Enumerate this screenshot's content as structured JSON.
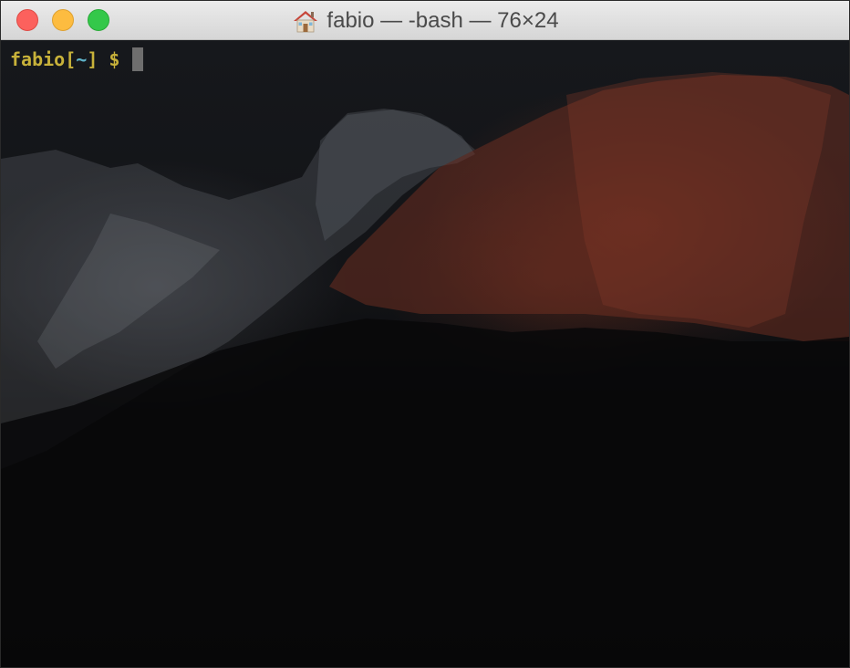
{
  "window": {
    "title": "fabio — -bash — 76×24",
    "title_icon": "home-icon"
  },
  "terminal": {
    "prompt": {
      "user": "fabio",
      "bracket_open": "[",
      "cwd": "~",
      "bracket_close": "]",
      "symbol": " $ "
    }
  },
  "colors": {
    "prompt_user": "#c8b23a",
    "prompt_cwd": "#5fb3c9",
    "close_button": "#fc615d",
    "minimize_button": "#fdbc40",
    "zoom_button": "#34c84a"
  }
}
